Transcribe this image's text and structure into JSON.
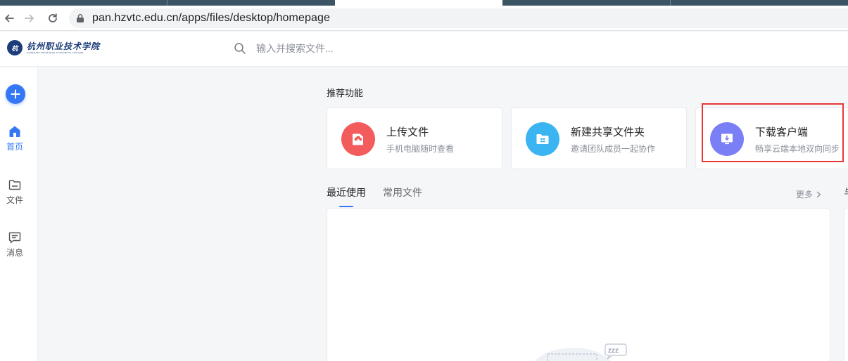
{
  "browser": {
    "url": "pan.hzvtc.edu.cn/apps/files/desktop/homepage"
  },
  "header": {
    "logo_name": "杭州职业技术学院",
    "logo_english": "HANGZHOU VOCATIONAL & TECHNICAL COLLEGE",
    "search_placeholder": "输入并搜索文件..."
  },
  "sidebar": {
    "items": [
      {
        "label": "首页",
        "icon": "home-icon",
        "active": true
      },
      {
        "label": "文件",
        "icon": "folder-icon",
        "active": false
      },
      {
        "label": "消息",
        "icon": "message-icon",
        "active": false
      }
    ]
  },
  "recommend": {
    "title": "推荐功能",
    "cards": [
      {
        "title": "上传文件",
        "subtitle": "手机电脑随时查看",
        "color": "#f25c5c",
        "icon": "upload-icon"
      },
      {
        "title": "新建共享文件夹",
        "subtitle": "邀请团队成员一起协作",
        "color": "#3bb4f2",
        "icon": "share-folder-icon"
      },
      {
        "title": "下载客户端",
        "subtitle": "畅享云端本地双向同步",
        "color": "#7b7ff5",
        "icon": "download-client-icon"
      }
    ]
  },
  "tabs": {
    "recent": "最近使用",
    "frequent": "常用文件",
    "more": "更多"
  },
  "colors": {
    "accent": "#3478f6",
    "highlight": "#e53935"
  }
}
